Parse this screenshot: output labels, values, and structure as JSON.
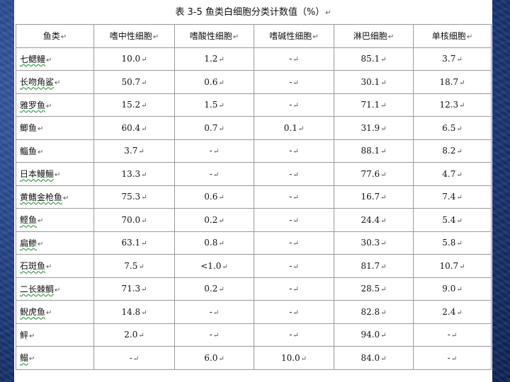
{
  "caption": "表 3-5  鱼类白细胞分类计数值（%）",
  "para_mark": "↵",
  "headers": [
    "鱼类",
    "嗜中性细胞",
    "嗜酸性细胞",
    "嗜碱性细胞",
    "淋巴细胞",
    "单核细胞"
  ],
  "rows": [
    {
      "fish": "七鳃鳗",
      "neutrophil": "10.0",
      "eosinophil": "1.2",
      "basophil": "-",
      "lymphocyte": "85.1",
      "monocyte": "3.7"
    },
    {
      "fish": "长吻角鲨",
      "neutrophil": "50.7",
      "eosinophil": "0.6",
      "basophil": "-",
      "lymphocyte": "30.1",
      "monocyte": "18.7"
    },
    {
      "fish": "雅罗鱼",
      "neutrophil": "15.2",
      "eosinophil": "1.5",
      "basophil": "-",
      "lymphocyte": "71.1",
      "monocyte": "12.3"
    },
    {
      "fish": "鲫鱼",
      "neutrophil": "60.4",
      "eosinophil": "0.7",
      "basophil": "0.1",
      "lymphocyte": "31.9",
      "monocyte": "6.5"
    },
    {
      "fish": "鲻鱼",
      "neutrophil": "3.7",
      "eosinophil": "-",
      "basophil": "-",
      "lymphocyte": "88.1",
      "monocyte": "8.2"
    },
    {
      "fish": "日本鳗鲡",
      "neutrophil": "13.3",
      "eosinophil": "-",
      "basophil": "-",
      "lymphocyte": "77.6",
      "monocyte": "4.7"
    },
    {
      "fish": "黄鳍金枪鱼",
      "neutrophil": "75.3",
      "eosinophil": "0.6",
      "basophil": "-",
      "lymphocyte": "16.7",
      "monocyte": "7.4"
    },
    {
      "fish": "鲣鱼",
      "neutrophil": "70.0",
      "eosinophil": "0.2",
      "basophil": "-",
      "lymphocyte": "24.4",
      "monocyte": "5.4"
    },
    {
      "fish": "扁鲹",
      "neutrophil": "63.1",
      "eosinophil": "0.8",
      "basophil": "-",
      "lymphocyte": "30.3",
      "monocyte": "5.8"
    },
    {
      "fish": "石斑鱼",
      "neutrophil": "7.5",
      "eosinophil": "<1.0",
      "basophil": "-",
      "lymphocyte": "81.7",
      "monocyte": "10.7"
    },
    {
      "fish": "二长棘鲷",
      "neutrophil": "71.3",
      "eosinophil": "0.2",
      "basophil": "-",
      "lymphocyte": "28.5",
      "monocyte": "9.0"
    },
    {
      "fish": "鲵虎鱼",
      "neutrophil": "14.8",
      "eosinophil": "-",
      "basophil": "-",
      "lymphocyte": "82.8",
      "monocyte": "2.4"
    },
    {
      "fish": "鲆",
      "neutrophil": "2.0",
      "eosinophil": "-",
      "basophil": "-",
      "lymphocyte": "94.0",
      "monocyte": "-"
    },
    {
      "fish": "鳎",
      "neutrophil": "-",
      "eosinophil": "6.0",
      "basophil": "10.0",
      "lymphocyte": "84.0",
      "monocyte": "-"
    }
  ]
}
